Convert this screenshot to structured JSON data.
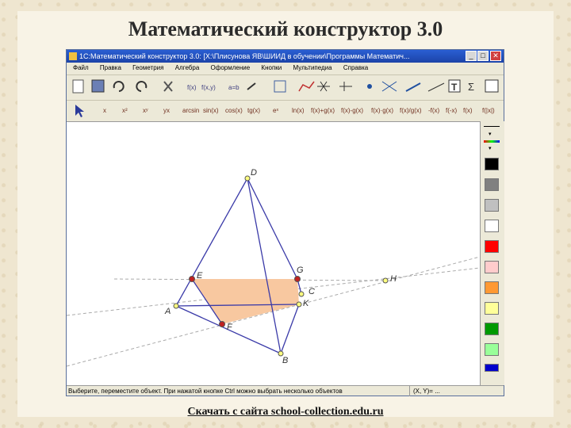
{
  "slide": {
    "title": "Математический конструктор 3.0",
    "footer_link": "Скачать с сайта school-collection.edu.ru"
  },
  "window": {
    "title": "1С:Математический конструктор 3.0: [X:\\Плисунова ЯВ\\ШИИД в обучении\\Программы Математич...",
    "menu": [
      "Файл",
      "Правка",
      "Геометрия",
      "Алгебра",
      "Оформление",
      "Кнопки",
      "Мультипедиа",
      "Справка"
    ],
    "toolbar2": [
      "x",
      "x²",
      "xʸ",
      "yx",
      "arcsin",
      "sin(x)",
      "cos(x)",
      "tg(x)",
      "eˣ",
      "ln(x)",
      "f(x)+g(x)",
      "f(x)-g(x)",
      "f(x)·g(x)",
      "f(x)/g(x)",
      "-f(x)",
      "f(-x)",
      "f(x)",
      "f(|x|)"
    ],
    "status": "Выберите, переместите объект. При нажатой кнопке Ctrl можно выбрать несколько объектов",
    "status_right": "(X, Y)= ..."
  },
  "figure": {
    "points": [
      "D",
      "E",
      "G",
      "C",
      "H",
      "K",
      "A",
      "F",
      "B"
    ],
    "fill_color": "#f8c8a0",
    "edge_color": "#3a3aa8"
  },
  "palette": [
    "#000000",
    "#808080",
    "#c0c0c0",
    "#ffffff",
    "#ff0000",
    "#ffcccc",
    "#ff9933",
    "#ffff99",
    "#009900",
    "#99ff99",
    "#0000cc"
  ]
}
